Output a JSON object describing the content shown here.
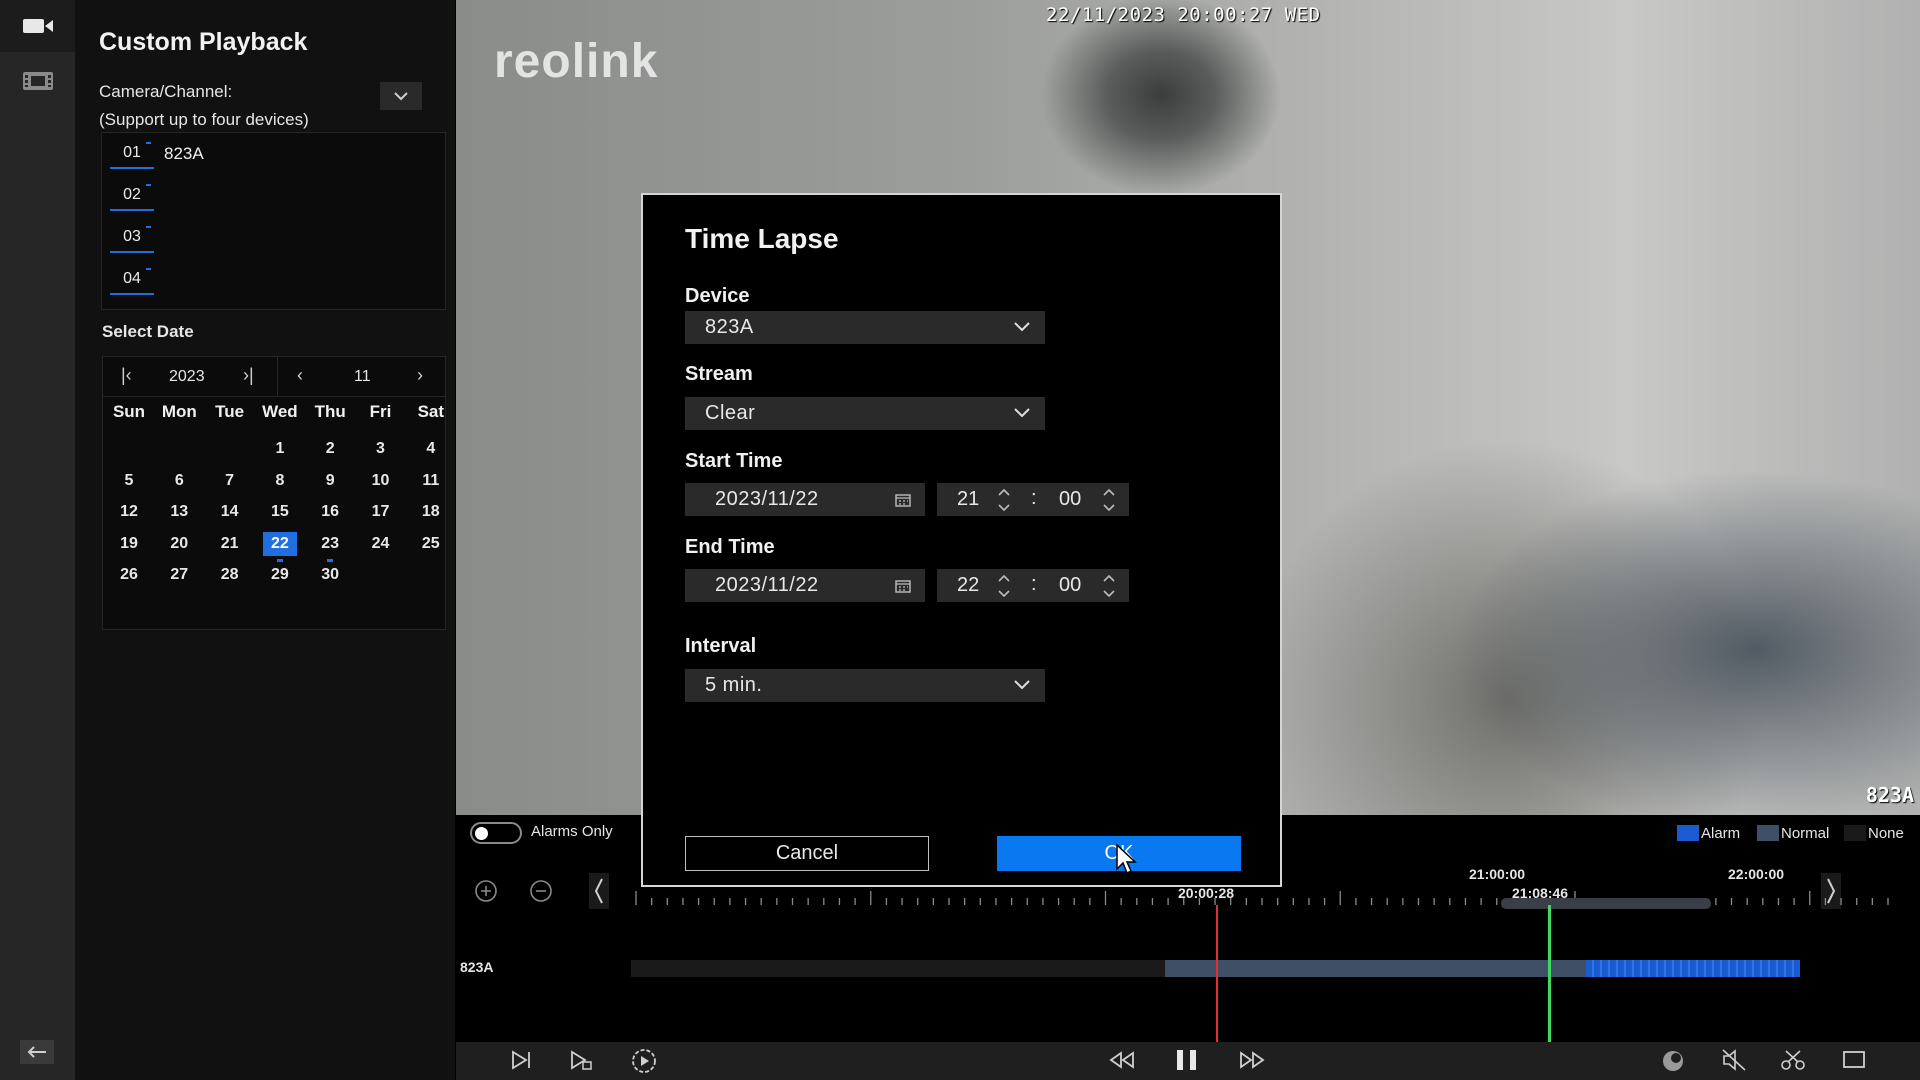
{
  "colors": {
    "accent": "#0a78f0",
    "alarm": "#1a5bd0",
    "normal": "#3e4f66",
    "cursor_red": "#e03030",
    "cursor_green": "#40d860"
  },
  "rail": {
    "icons": [
      "video-camera-icon",
      "film-strip-icon",
      "collapse-arrow-icon"
    ]
  },
  "panel": {
    "title": "Custom Playback",
    "camera_label": "Camera/Channel:",
    "camera_sublabel": "(Support up to four devices)",
    "channels": [
      {
        "num": "01",
        "name": "823A"
      },
      {
        "num": "02",
        "name": ""
      },
      {
        "num": "03",
        "name": ""
      },
      {
        "num": "04",
        "name": ""
      }
    ],
    "select_date_label": "Select Date",
    "calendar": {
      "year": "2023",
      "month": "11",
      "weekdays": [
        "Sun",
        "Mon",
        "Tue",
        "Wed",
        "Thu",
        "Fri",
        "Sat"
      ],
      "weeks": [
        [
          "",
          "",
          "",
          "1",
          "2",
          "3",
          "4"
        ],
        [
          "5",
          "6",
          "7",
          "8",
          "9",
          "10",
          "11"
        ],
        [
          "12",
          "13",
          "14",
          "15",
          "16",
          "17",
          "18"
        ],
        [
          "19",
          "20",
          "21",
          "22",
          "23",
          "24",
          "25"
        ],
        [
          "26",
          "27",
          "28",
          "29",
          "30",
          "",
          ""
        ]
      ],
      "selected_day": "22",
      "marked_days": [
        "22",
        "23"
      ]
    }
  },
  "video": {
    "osd_time": "22/11/2023 20:00:27 WED",
    "logo": "reolink",
    "camera_name": "823A"
  },
  "timeline": {
    "alarms_only_label": "Alarms Only",
    "alarms_only_on": false,
    "legend": [
      "Alarm",
      "Normal",
      "None"
    ],
    "labels": {
      "current": "20:00:28",
      "t21": "21:00:00",
      "t22": "22:00:00",
      "hover": "21:08:46"
    },
    "row_label": "823A"
  },
  "dialog": {
    "title": "Time Lapse",
    "device_label": "Device",
    "device_value": "823A",
    "stream_label": "Stream",
    "stream_value": "Clear",
    "start_label": "Start Time",
    "start_date": "2023/11/22",
    "start_hour": "21",
    "start_min": "00",
    "end_label": "End Time",
    "end_date": "2023/11/22",
    "end_hour": "22",
    "end_min": "00",
    "interval_label": "Interval",
    "interval_value": "5 min.",
    "cancel_label": "Cancel",
    "ok_label": "OK",
    "colon": ":"
  }
}
